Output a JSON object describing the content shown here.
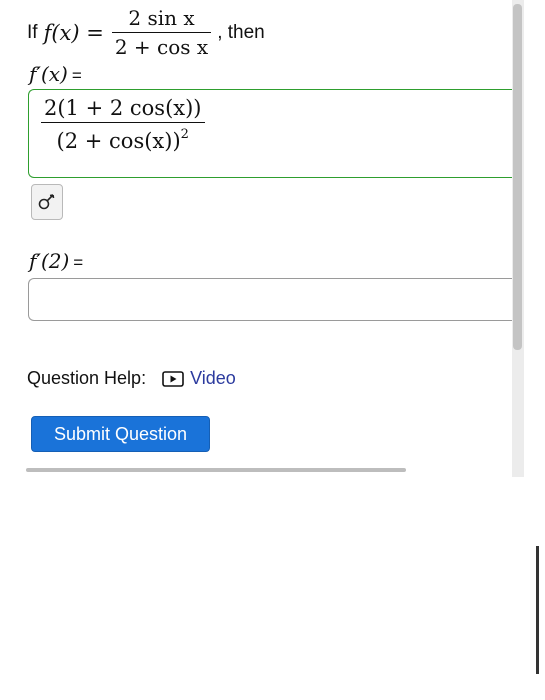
{
  "question": {
    "lead": "If",
    "given_lhs": "f(x) =",
    "given_numerator": "2 sin x",
    "given_denominator": "2 + cos x",
    "trailing": ", then"
  },
  "derivative_part": {
    "label": "f′(x)",
    "equals": "=",
    "answer": {
      "numerator": "2(1 + 2 cos(x))",
      "denominator": "(2 + cos(x))",
      "exponent": "2"
    }
  },
  "preview": {
    "icon": "preview-eye-icon"
  },
  "value_part": {
    "label": "f′(2)",
    "equals": "=",
    "value": ""
  },
  "help": {
    "label": "Question Help:",
    "video_label": "Video",
    "video_icon": "play-icon"
  },
  "submit": {
    "label": "Submit Question"
  },
  "colors": {
    "submit_bg": "#1a73d9",
    "correct_border": "#2e9e2e",
    "link": "#2b3a9e"
  }
}
